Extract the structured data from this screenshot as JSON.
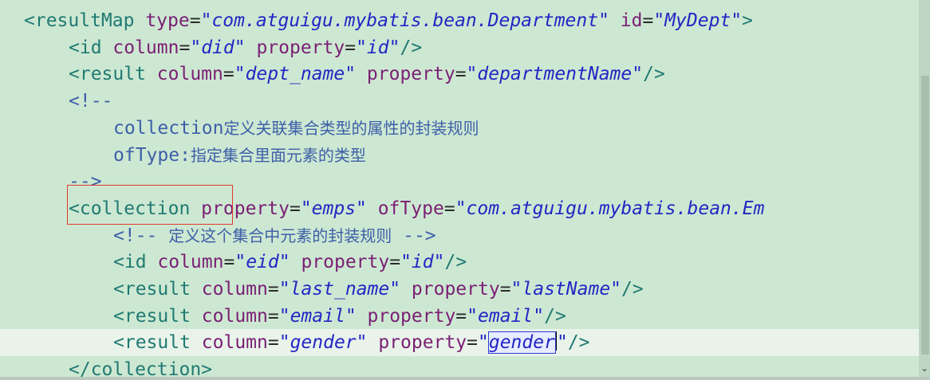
{
  "editor": {
    "lines": [
      {
        "indent": 2,
        "tokens": [
          {
            "t": "<resultMap",
            "c": "tag"
          },
          {
            "t": " type",
            "c": "attr"
          },
          {
            "t": "=",
            "c": "punct"
          },
          {
            "t": "\"com.atguigu.mybatis.bean.Department\"",
            "c": "str"
          },
          {
            "t": " id",
            "c": "attr"
          },
          {
            "t": "=",
            "c": "punct"
          },
          {
            "t": "\"MyDept\"",
            "c": "str"
          },
          {
            "t": ">",
            "c": "tag"
          }
        ]
      },
      {
        "indent": 6,
        "tokens": [
          {
            "t": "<id",
            "c": "tag"
          },
          {
            "t": " column",
            "c": "attr"
          },
          {
            "t": "=",
            "c": "punct"
          },
          {
            "t": "\"did\"",
            "c": "str"
          },
          {
            "t": " property",
            "c": "attr"
          },
          {
            "t": "=",
            "c": "punct"
          },
          {
            "t": "\"id\"",
            "c": "str"
          },
          {
            "t": "/>",
            "c": "tag"
          }
        ]
      },
      {
        "indent": 6,
        "tokens": [
          {
            "t": "<result",
            "c": "tag"
          },
          {
            "t": " column",
            "c": "attr"
          },
          {
            "t": "=",
            "c": "punct"
          },
          {
            "t": "\"dept_name\"",
            "c": "str"
          },
          {
            "t": " property",
            "c": "attr"
          },
          {
            "t": "=",
            "c": "punct"
          },
          {
            "t": "\"departmentName\"",
            "c": "str"
          },
          {
            "t": "/>",
            "c": "tag"
          }
        ]
      },
      {
        "indent": 6,
        "tokens": [
          {
            "t": "<!--",
            "c": "comment"
          }
        ]
      },
      {
        "indent": 10,
        "tokens": [
          {
            "t": "collection",
            "c": "comment"
          },
          {
            "t": "定义关联集合类型的属性的封装规则",
            "c": "cjk"
          }
        ]
      },
      {
        "indent": 10,
        "tokens": [
          {
            "t": "ofType:",
            "c": "comment"
          },
          {
            "t": "指定集合里面元素的类型",
            "c": "cjk"
          }
        ]
      },
      {
        "indent": 6,
        "tokens": [
          {
            "t": "-->",
            "c": "comment"
          }
        ]
      },
      {
        "indent": 6,
        "tokens": [
          {
            "t": "<collection",
            "c": "tag"
          },
          {
            "t": " property",
            "c": "attr"
          },
          {
            "t": "=",
            "c": "punct"
          },
          {
            "t": "\"emps\"",
            "c": "str"
          },
          {
            "t": " ofType",
            "c": "attr"
          },
          {
            "t": "=",
            "c": "punct"
          },
          {
            "t": "\"com.atguigu.mybatis.bean.Em",
            "c": "str"
          }
        ]
      },
      {
        "indent": 10,
        "tokens": [
          {
            "t": "<!-- ",
            "c": "comment"
          },
          {
            "t": "定义这个集合中元素的封装规则",
            "c": "cjk"
          },
          {
            "t": " -->",
            "c": "comment"
          }
        ]
      },
      {
        "indent": 10,
        "tokens": [
          {
            "t": "<id",
            "c": "tag"
          },
          {
            "t": " column",
            "c": "attr"
          },
          {
            "t": "=",
            "c": "punct"
          },
          {
            "t": "\"eid\"",
            "c": "str"
          },
          {
            "t": " property",
            "c": "attr"
          },
          {
            "t": "=",
            "c": "punct"
          },
          {
            "t": "\"id\"",
            "c": "str"
          },
          {
            "t": "/>",
            "c": "tag"
          }
        ]
      },
      {
        "indent": 10,
        "tokens": [
          {
            "t": "<result",
            "c": "tag"
          },
          {
            "t": " column",
            "c": "attr"
          },
          {
            "t": "=",
            "c": "punct"
          },
          {
            "t": "\"last_name\"",
            "c": "str"
          },
          {
            "t": " property",
            "c": "attr"
          },
          {
            "t": "=",
            "c": "punct"
          },
          {
            "t": "\"lastName\"",
            "c": "str"
          },
          {
            "t": "/>",
            "c": "tag"
          }
        ]
      },
      {
        "indent": 10,
        "tokens": [
          {
            "t": "<result",
            "c": "tag"
          },
          {
            "t": " column",
            "c": "attr"
          },
          {
            "t": "=",
            "c": "punct"
          },
          {
            "t": "\"email\"",
            "c": "str"
          },
          {
            "t": " property",
            "c": "attr"
          },
          {
            "t": "=",
            "c": "punct"
          },
          {
            "t": "\"email\"",
            "c": "str"
          },
          {
            "t": "/>",
            "c": "tag"
          }
        ]
      },
      {
        "indent": 10,
        "current": true,
        "tokens": [
          {
            "t": "<result",
            "c": "tag"
          },
          {
            "t": " column",
            "c": "attr"
          },
          {
            "t": "=",
            "c": "punct"
          },
          {
            "t": "\"gender\"",
            "c": "str"
          },
          {
            "t": " property",
            "c": "attr"
          },
          {
            "t": "=",
            "c": "punct"
          },
          {
            "t": "\"",
            "c": "str"
          },
          {
            "t": "gender",
            "c": "str",
            "sel": true,
            "caret": true
          },
          {
            "t": "\"",
            "c": "str"
          },
          {
            "t": "/>",
            "c": "tag"
          }
        ]
      },
      {
        "indent": 6,
        "tokens": [
          {
            "t": "</collection>",
            "c": "tag"
          }
        ]
      }
    ]
  }
}
